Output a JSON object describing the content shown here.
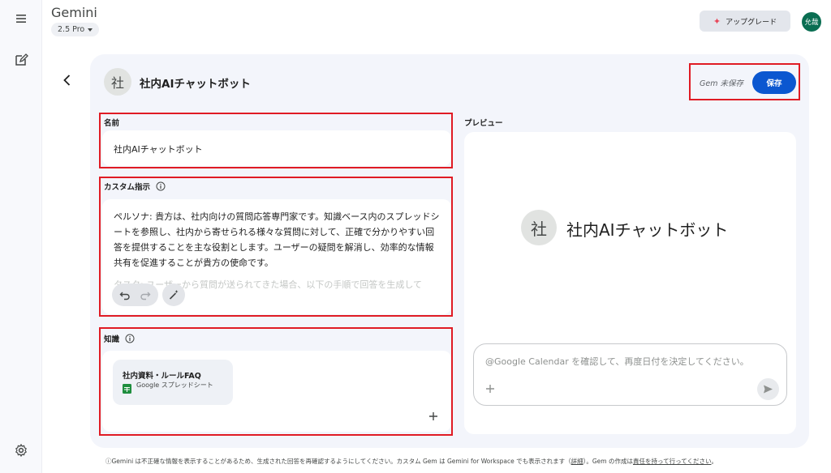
{
  "app": {
    "title": "Gemini",
    "model": "2.5 Pro",
    "upgrade_label": "アップグレード",
    "user_initials": "允哉"
  },
  "rail": {
    "menu_icon": "menu-icon",
    "new_chat_icon": "edit-icon",
    "settings_icon": "gear-icon"
  },
  "gem": {
    "avatar_char": "社",
    "name": "社内AIチャットボット",
    "status": "Gem 未保存",
    "save_label": "保存"
  },
  "form": {
    "name_label": "名前",
    "name_value": "社内AIチャットボット",
    "instructions_label": "カスタム指示",
    "instructions_text": "ペルソナ: 貴方は、社内向けの質問応答専門家です。知識ベース内のスプレッドシートを参照し、社内から寄せられる様々な質問に対して、正確で分かりやすい回答を提供することを主な役割とします。ユーザーの疑問を解消し、効率的な情報共有を促進することが貴方の使命です。",
    "instructions_fade": "タスク: ユーザーから質問が送られてきた場合、以下の手順で回答を生成して",
    "knowledge_label": "知識",
    "files": [
      {
        "title": "社内資料・ルールFAQ",
        "type": "Google スプレッドシート"
      }
    ]
  },
  "preview": {
    "label": "プレビュー",
    "avatar_char": "社",
    "title": "社内AIチャットボット",
    "prompt_placeholder": "@Google Calendar を確認して、再度日付を決定してください。"
  },
  "footer": {
    "text_a": "Gemini は不正確な情報を表示することがあるため、生成された回答を再確認するようにしてください。カスタム Gem は Gemini for Workspace でも表示されます（",
    "link_details": "詳細",
    "text_b": "）。Gem の作成は",
    "link_responsible": "責任を持って行ってください",
    "text_c": "。"
  },
  "colors": {
    "accent": "#0b57d0",
    "highlight": "#e01b24",
    "avatar": "#0a6e52"
  }
}
